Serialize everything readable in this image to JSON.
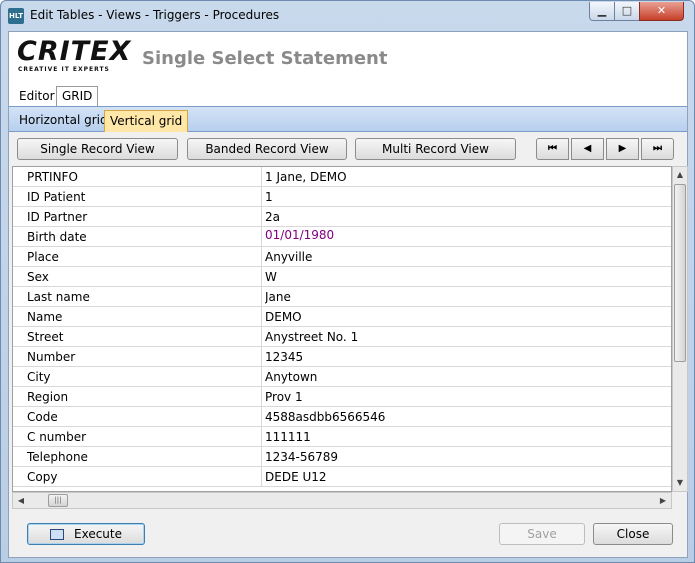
{
  "window": {
    "title": "Edit Tables - Views - Triggers - Procedures",
    "app_icon_text": "HLT",
    "controls": {
      "minimize": "▁",
      "maximize": "□",
      "close": "✕"
    }
  },
  "header": {
    "logo_text": "CRITEX",
    "logo_tagline": "CREATIVE IT EXPERTS",
    "page_title": "Single Select Statement"
  },
  "tabs_top": [
    {
      "label": "Editor",
      "selected": false
    },
    {
      "label": "GRID",
      "selected": true
    }
  ],
  "tabs_grid": [
    {
      "label": "Horizontal grid",
      "selected": false
    },
    {
      "label": "Vertical grid",
      "selected": true
    }
  ],
  "toolbar": {
    "single_record": "Single Record View",
    "banded_record": "Banded Record View",
    "multi_record": "Multi Record View",
    "nav_first": "⏮",
    "nav_prev": "◀",
    "nav_next": "▶",
    "nav_last": "⏭"
  },
  "grid": {
    "rows": [
      {
        "field": "PRTINFO",
        "value": "1 Jane, DEMO"
      },
      {
        "field": "ID Patient",
        "value": "1"
      },
      {
        "field": "ID Partner",
        "value": "2a"
      },
      {
        "field": "Birth date",
        "value": "01/01/1980"
      },
      {
        "field": "Place",
        "value": "Anyville"
      },
      {
        "field": "Sex",
        "value": "W"
      },
      {
        "field": "Last name",
        "value": "Jane"
      },
      {
        "field": "Name",
        "value": "DEMO"
      },
      {
        "field": "Street",
        "value": "Anystreet No. 1"
      },
      {
        "field": "Number",
        "value": "12345"
      },
      {
        "field": "City",
        "value": "Anytown"
      },
      {
        "field": "Region",
        "value": "Prov 1"
      },
      {
        "field": "Code",
        "value": "4588asdbb6566546"
      },
      {
        "field": "C number",
        "value": "111111"
      },
      {
        "field": "Telephone",
        "value": "1234-56789"
      },
      {
        "field": "Copy",
        "value": "DEDE U12"
      }
    ],
    "date_color": "#800080"
  },
  "bottom": {
    "execute": "Execute",
    "save": "Save",
    "close": "Close"
  }
}
